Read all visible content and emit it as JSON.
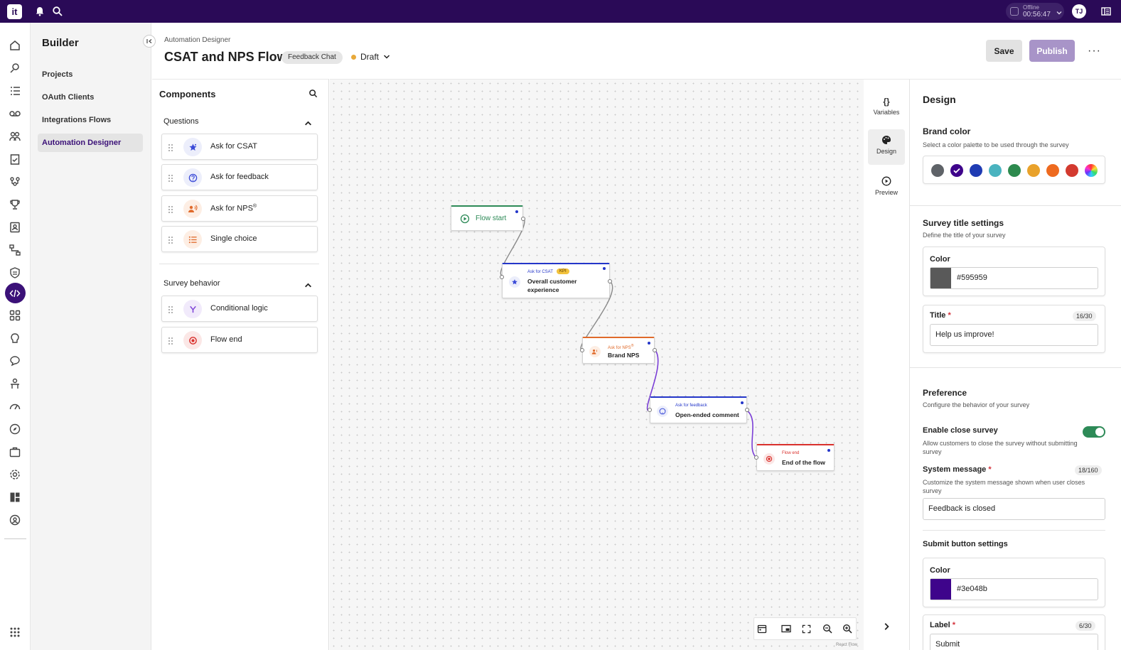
{
  "topbar": {
    "logo_text": "it",
    "status_label": "Offline",
    "timer": "00:56:47",
    "avatar_initials": "TJ"
  },
  "sidebar": {
    "title": "Builder",
    "items": [
      {
        "label": "Projects",
        "active": false
      },
      {
        "label": "OAuth Clients",
        "active": false
      },
      {
        "label": "Integrations Flows",
        "active": false
      },
      {
        "label": "Automation Designer",
        "active": true
      }
    ]
  },
  "header": {
    "breadcrumb": "Automation Designer",
    "title": "CSAT and NPS Flow",
    "chip": "Feedback Chat",
    "status": "Draft",
    "save_label": "Save",
    "publish_label": "Publish",
    "more_label": "···"
  },
  "components": {
    "title": "Components",
    "questions_title": "Questions",
    "questions": [
      {
        "label": "Ask for CSAT",
        "icon": "star-icon",
        "color": "#3b4bd8"
      },
      {
        "label": "Ask for feedback",
        "icon": "question-circle-icon",
        "color": "#3b4bd8"
      },
      {
        "label": "Ask for NPS",
        "sup": "®",
        "icon": "people-speak-icon",
        "color": "#e06a2b"
      },
      {
        "label": "Single choice",
        "icon": "list-icon",
        "color": "#e06a2b"
      }
    ],
    "behavior_title": "Survey behavior",
    "behavior": [
      {
        "label": "Conditional logic",
        "icon": "branch-icon",
        "color": "#7b3fd6"
      },
      {
        "label": "Flow end",
        "icon": "stop-icon",
        "color": "#d9302c"
      }
    ]
  },
  "canvas": {
    "watermark": "React Flow",
    "nodes": {
      "start": {
        "label": "Flow start"
      },
      "csat": {
        "type": "Ask for CSAT",
        "badge": "KPI",
        "label_line1": "Overall customer",
        "label_line2": "experience"
      },
      "nps": {
        "type": "Ask for NPS",
        "type_sup": "®",
        "label": "Brand NPS"
      },
      "feedback": {
        "type": "Ask for feedback",
        "label": "Open-ended comment"
      },
      "end": {
        "type": "Flow end",
        "label": "End of the flow"
      }
    }
  },
  "tabs": [
    {
      "label": "Variables",
      "icon": "braces-icon"
    },
    {
      "label": "Design",
      "icon": "palette-icon",
      "active": true
    },
    {
      "label": "Preview",
      "icon": "play-circle-icon"
    }
  ],
  "design": {
    "title": "Design",
    "brand_color_title": "Brand color",
    "brand_color_sub": "Select a color palette to be used through the survey",
    "palette": [
      "#5f6368",
      "#3e048b",
      "#1f3bb3",
      "#4ab3bf",
      "#2d8a4e",
      "#e9a22b",
      "#ee6a1f",
      "#d33a2f",
      "rainbow"
    ],
    "selected_palette_index": 1,
    "survey_title_title": "Survey title settings",
    "survey_title_sub": "Define the title of your survey",
    "title_color_label": "Color",
    "title_color_value": "#595959",
    "title_label": "Title",
    "title_counter": "16/30",
    "title_value": "Help us improve!",
    "preference_title": "Preference",
    "preference_sub": "Configure the behavior of your survey",
    "close_label": "Enable close survey",
    "close_sub": "Allow customers to close the survey without submitting survey",
    "close_enabled": true,
    "system_msg_label": "System message",
    "system_msg_counter": "18/160",
    "system_msg_sub": "Customize the system message shown when user closes survey",
    "system_msg_value": "Feedback is closed",
    "submit_title": "Submit button settings",
    "submit_color_label": "Color",
    "submit_color_value": "#3e048b",
    "submit_label_label": "Label",
    "submit_label_counter": "6/30",
    "submit_label_value": "Submit"
  }
}
